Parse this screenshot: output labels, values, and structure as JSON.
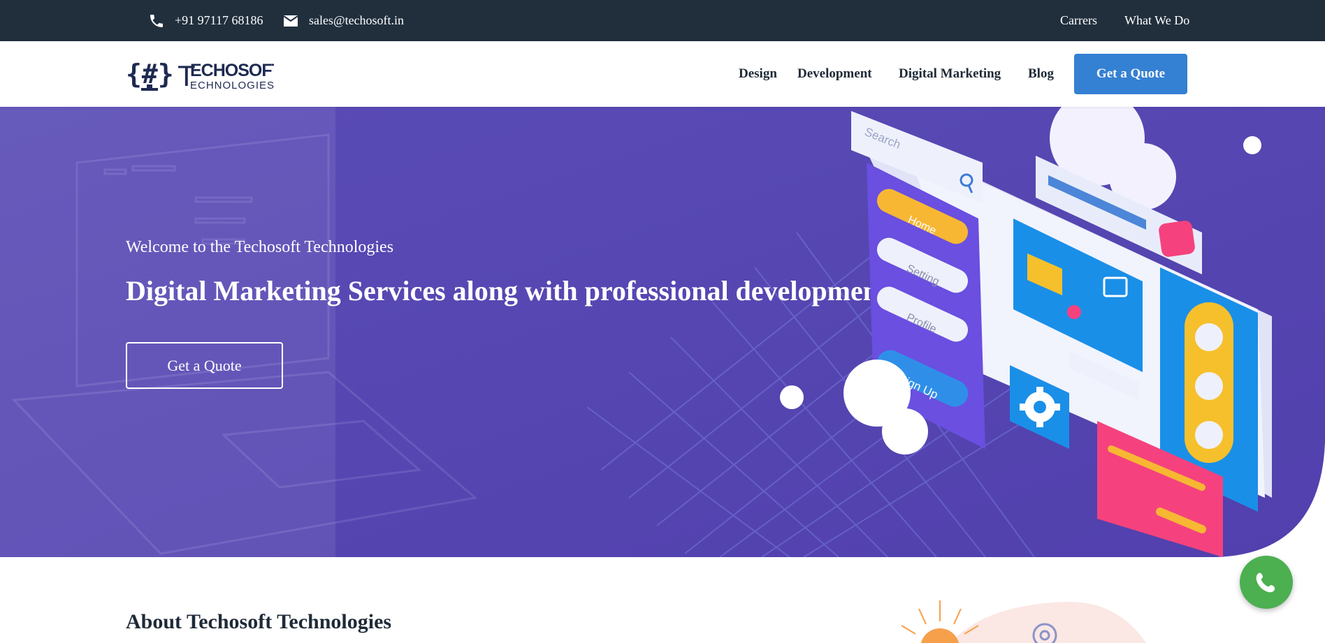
{
  "topbar": {
    "phone": "+91 97117 68186",
    "email": "sales@techosoft.in",
    "links": [
      "Carrers",
      "What We Do"
    ]
  },
  "header": {
    "logo_text_top": "ECHOSOFT",
    "logo_text_bottom": "ECHNOLOGIES",
    "logo_letter": "T",
    "logo_symbol": "{#}",
    "nav": [
      "Design",
      "Development",
      "Digital Marketing",
      "Blog"
    ],
    "cta_label": "Get a Quote"
  },
  "hero": {
    "welcome": "Welcome to the Techosoft Technologies",
    "headline": "Digital Marketing Services along with professional development",
    "cta_label": "Get a Quote",
    "illustration": {
      "search_label": "Search",
      "menu_items": [
        "Home",
        "Setting",
        "Profile"
      ],
      "signup_label": "Sign Up"
    }
  },
  "about": {
    "title": "About Techosoft Technologies"
  },
  "colors": {
    "topbar": "#212f3d",
    "hero_bg": "#5544b0",
    "accent": "#3480d2",
    "whatsapp": "#4caf50"
  },
  "icons": [
    "phone-icon",
    "mail-icon",
    "whatsapp-icon",
    "search-icon",
    "gear-icon"
  ]
}
